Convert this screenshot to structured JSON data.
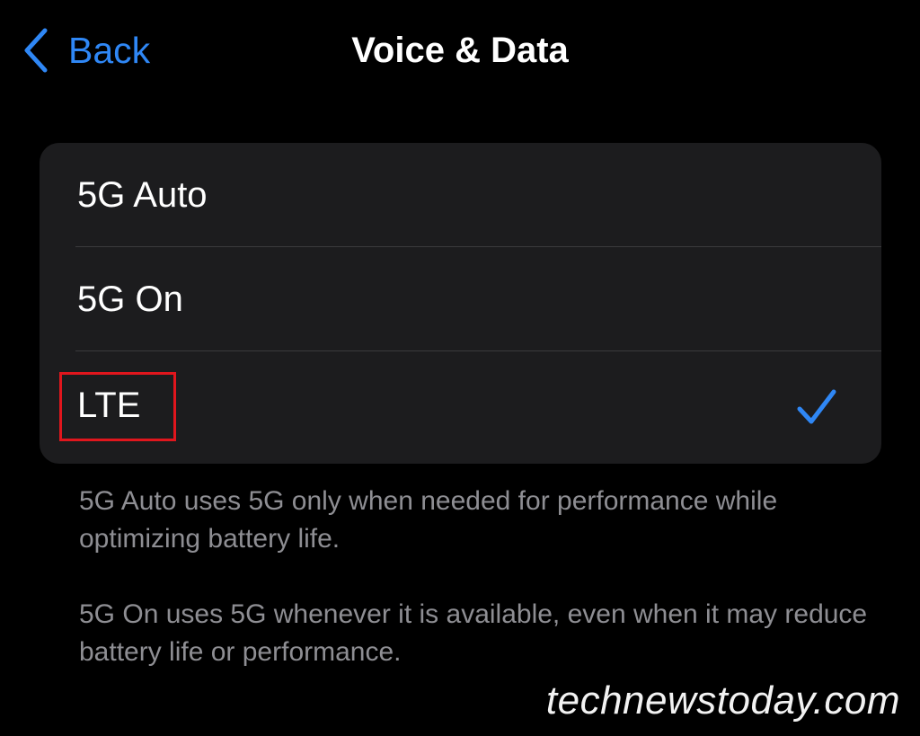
{
  "nav": {
    "back_label": "Back",
    "title": "Voice & Data"
  },
  "options": [
    {
      "label": "5G Auto",
      "selected": false
    },
    {
      "label": "5G On",
      "selected": false
    },
    {
      "label": "LTE",
      "selected": true
    }
  ],
  "footer": {
    "note_1": "5G Auto uses 5G only when needed for performance while optimizing battery life.",
    "note_2": "5G On uses 5G whenever it is available, even when it may reduce battery life or performance."
  },
  "watermark": "technewstoday.com",
  "colors": {
    "accent": "#2f87f5",
    "background": "#000000",
    "group_background": "#1c1c1e",
    "highlight": "#e0161d",
    "secondary_text": "#8e8e93"
  },
  "icons": {
    "back": "chevron-left-icon",
    "selected": "checkmark-icon"
  }
}
